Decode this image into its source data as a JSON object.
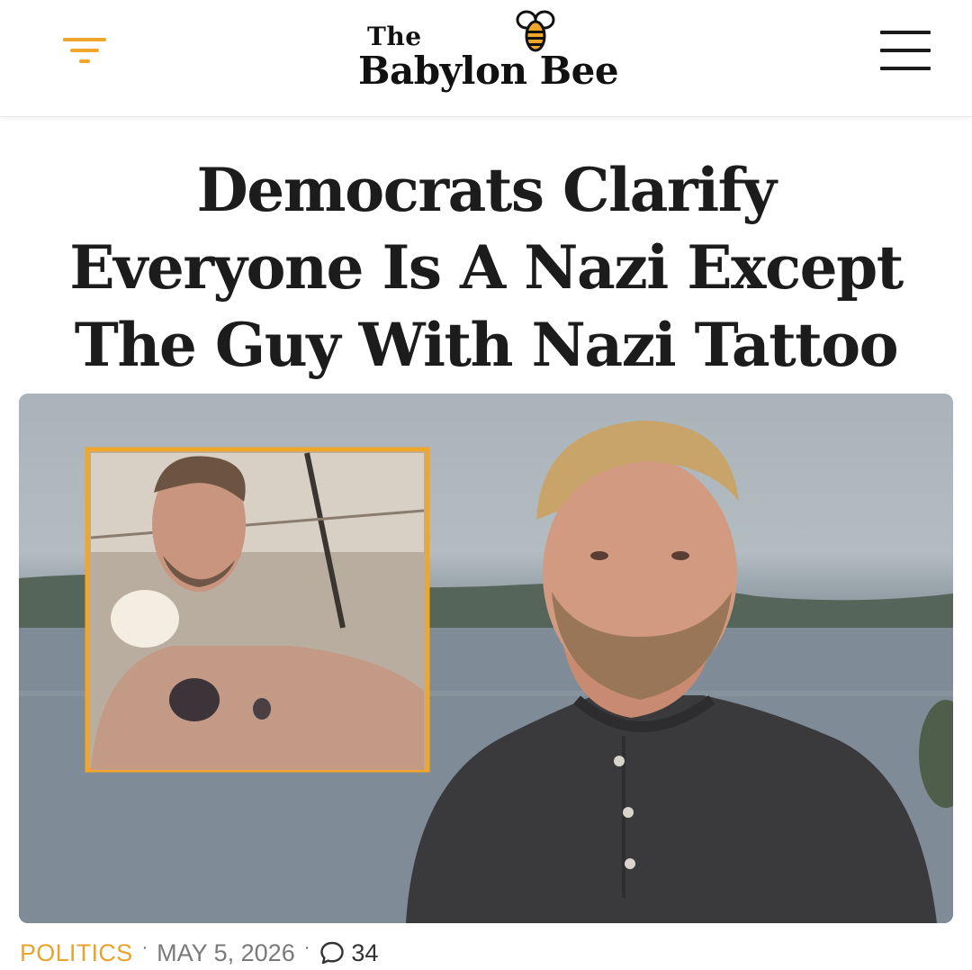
{
  "header": {
    "logo_top": "The",
    "logo_main": "Babylon Bee",
    "accent_color": "#f0a52b",
    "icons": [
      "filter-icon",
      "bee-icon",
      "hamburger-menu-icon"
    ]
  },
  "article": {
    "headline_lines": [
      "Democrats Clarify",
      "Everyone Is A Nazi Except",
      "The Guy With Nazi Tattoo"
    ],
    "category": "POLITICS",
    "date": "MAY 5, 2026",
    "comment_count": "34",
    "category_color": "#e9a22c"
  }
}
